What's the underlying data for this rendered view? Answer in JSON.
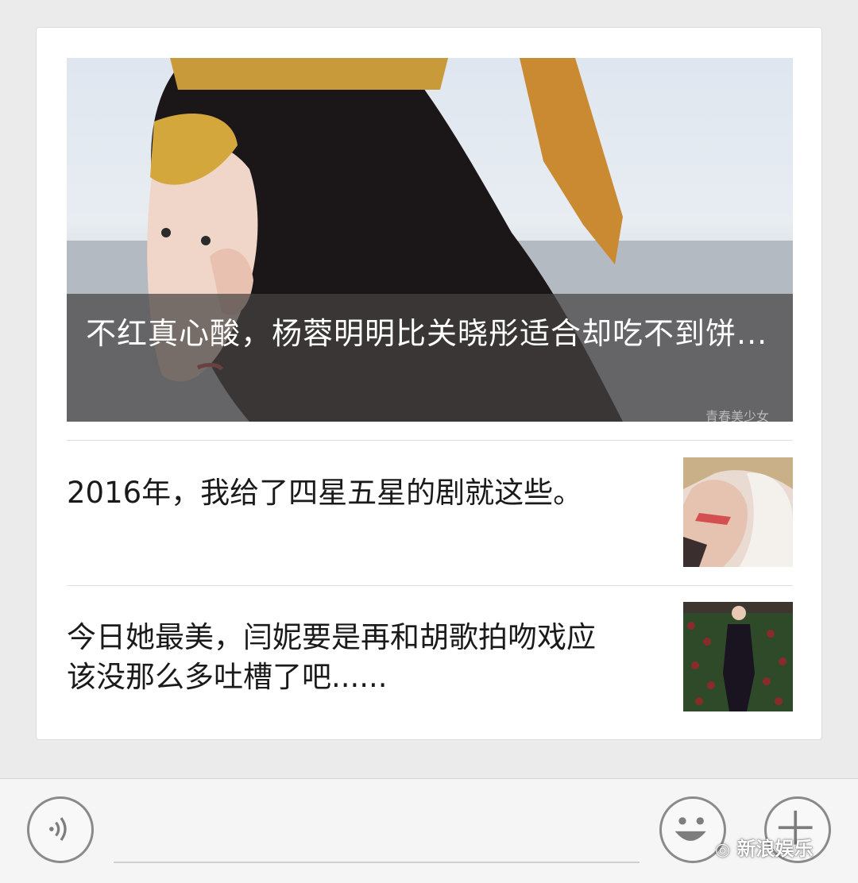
{
  "card": {
    "hero": {
      "title": "不红真心酸，杨蓉明明比关晓彤适合却吃不到饼...",
      "watermark": "青春美少女"
    },
    "articles": [
      {
        "title": "2016年，我给了四星五星的剧就这些。"
      },
      {
        "title": "今日她最美，闫妮要是再和胡歌拍吻戏应该没那么多吐槽了吧......"
      }
    ]
  },
  "input_bar": {
    "voice_icon": "voice-icon",
    "emoji_icon": "emoji-icon",
    "plus_icon": "plus-icon"
  },
  "brand_watermark": "新浪娱乐"
}
